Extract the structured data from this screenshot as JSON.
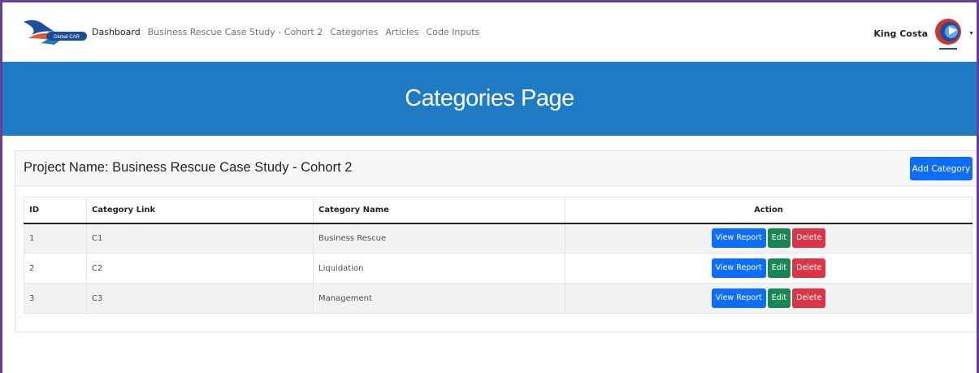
{
  "nav": {
    "logo_text": "Global-CAR",
    "links": [
      {
        "label": "Dashboard",
        "active": true
      },
      {
        "label": "Business Rescue Case Study - Cohort 2",
        "active": false
      },
      {
        "label": "Categories",
        "active": false
      },
      {
        "label": "Articles",
        "active": false
      },
      {
        "label": "Code Inputs",
        "active": false
      }
    ],
    "user_name": "King Costa"
  },
  "banner": {
    "title": "Categories Page"
  },
  "card": {
    "project_name": "Project Name: Business Rescue Case Study - Cohort 2",
    "add_label": "Add Category"
  },
  "table": {
    "headers": [
      "ID",
      "Category Link",
      "Category Name",
      "Action"
    ],
    "rows": [
      {
        "id": "1",
        "link": "C1",
        "name": "Business Rescue"
      },
      {
        "id": "2",
        "link": "C2",
        "name": "Liquidation"
      },
      {
        "id": "3",
        "link": "C3",
        "name": "Management"
      }
    ],
    "actions": {
      "view": "View Report",
      "edit": "Edit",
      "delete": "Delete"
    }
  },
  "colors": {
    "banner": "#1e7bc4",
    "primary": "#0d6efd",
    "success": "#198754",
    "danger": "#dc3545",
    "frame": "#6a3d9a"
  }
}
